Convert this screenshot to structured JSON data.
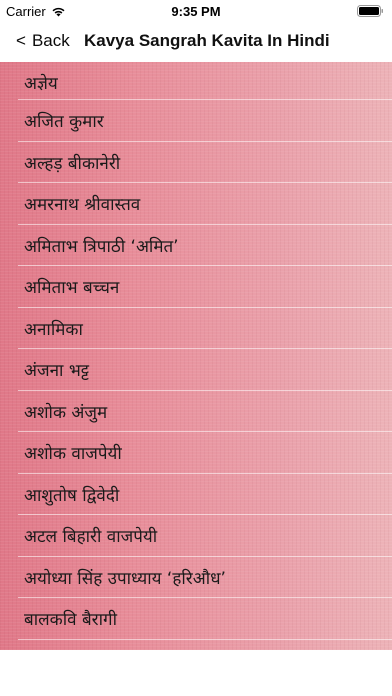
{
  "status_bar": {
    "carrier": "Carrier",
    "time": "9:35 PM",
    "icons": [
      "wifi-icon",
      "battery-icon"
    ]
  },
  "nav": {
    "back_label": "Back",
    "back_chevron": "<",
    "title": "Kavya Sangrah Kavita In Hindi"
  },
  "poets": [
    "अज्ञेय",
    "अजित कुमार",
    "अल्हड़ बीकानेरी",
    "अमरनाथ श्रीवास्तव",
    "अमिताभ त्रिपाठी ‘अमित’",
    "अमिताभ बच्चन",
    "अनामिका",
    "अंजना भट्ट",
    "अशोक अंजुम",
    "अशोक वाजपेयी",
    "आशुतोष द्विवेदी",
    "अटल बिहारी वाजपेयी",
    "अयोध्या सिंह उपाध्याय ‘हरिऔध’",
    "बालकवि बैरागी"
  ],
  "colors": {
    "list_gradient_start": "#e07888",
    "list_gradient_end": "#edb3b8",
    "text": "#1a1a1a"
  }
}
